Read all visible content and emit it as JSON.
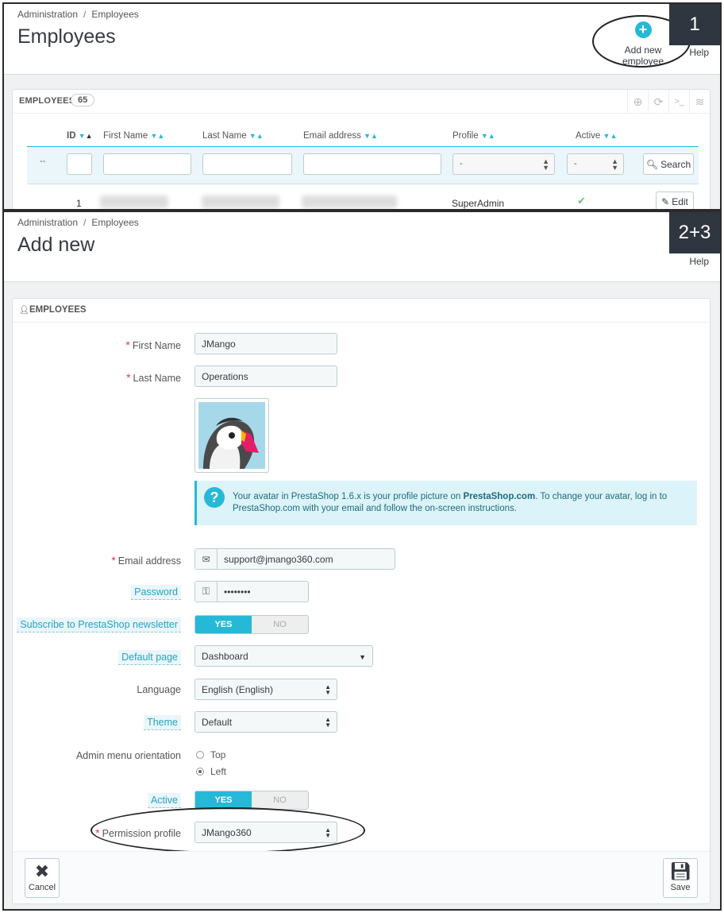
{
  "screen1": {
    "breadcrumb": [
      "Administration",
      "Employees"
    ],
    "title": "Employees",
    "step_badge": "1",
    "add_new_label": "Add new employee",
    "add_new_icon": "plus-circle-icon",
    "help_label": "Help",
    "list": {
      "title": "EMPLOYEES",
      "count": "65",
      "tools": [
        "plus-circle-icon",
        "refresh-icon",
        "terminal-icon",
        "database-icon"
      ],
      "columns": {
        "id": "ID",
        "first_name": "First Name",
        "last_name": "Last Name",
        "email": "Email address",
        "profile": "Profile",
        "active": "Active"
      },
      "filter": {
        "dash": "--",
        "profile_value": "-",
        "active_value": "-",
        "search_label": "Search"
      },
      "rows": [
        {
          "id": "1",
          "profile": "SuperAdmin",
          "active_icon": "check-icon",
          "edit_label": "Edit"
        }
      ]
    }
  },
  "screen2": {
    "breadcrumb": [
      "Administration",
      "Employees"
    ],
    "title": "Add new",
    "step_badge": "2+3",
    "help_label": "Help",
    "panel_title": "EMPLOYEES",
    "fields": {
      "first_name": {
        "label": "First Name",
        "value": "JMango"
      },
      "last_name": {
        "label": "Last Name",
        "value": "Operations"
      },
      "email": {
        "label": "Email address",
        "value": "support@jmango360.com"
      },
      "password": {
        "label": "Password",
        "value": "••••••••"
      },
      "newsletter": {
        "label": "Subscribe to PrestaShop newsletter",
        "yes": "YES",
        "no": "NO",
        "selected": "YES"
      },
      "default_page": {
        "label": "Default page",
        "value": "Dashboard"
      },
      "language": {
        "label": "Language",
        "value": "English (English)"
      },
      "theme": {
        "label": "Theme",
        "value": "Default"
      },
      "menu_orientation": {
        "label": "Admin menu orientation",
        "options": [
          "Top",
          "Left"
        ],
        "selected": "Left"
      },
      "active": {
        "label": "Active",
        "yes": "YES",
        "no": "NO",
        "selected": "YES"
      },
      "permission_profile": {
        "label": "Permission profile",
        "value": "JMango360"
      }
    },
    "info": {
      "text_before": "Your avatar in PrestaShop 1.6.x is your profile picture on ",
      "link": "PrestaShop.com",
      "text_after": ". To change your avatar, log in to PrestaShop.com with your email and follow the on-screen instructions."
    },
    "footer": {
      "cancel_label": "Cancel",
      "save_label": "Save"
    }
  },
  "colors": {
    "accent": "#25b9d7",
    "required": "#e23b3b",
    "success": "#72c279",
    "badge_bg": "#2f3640"
  }
}
